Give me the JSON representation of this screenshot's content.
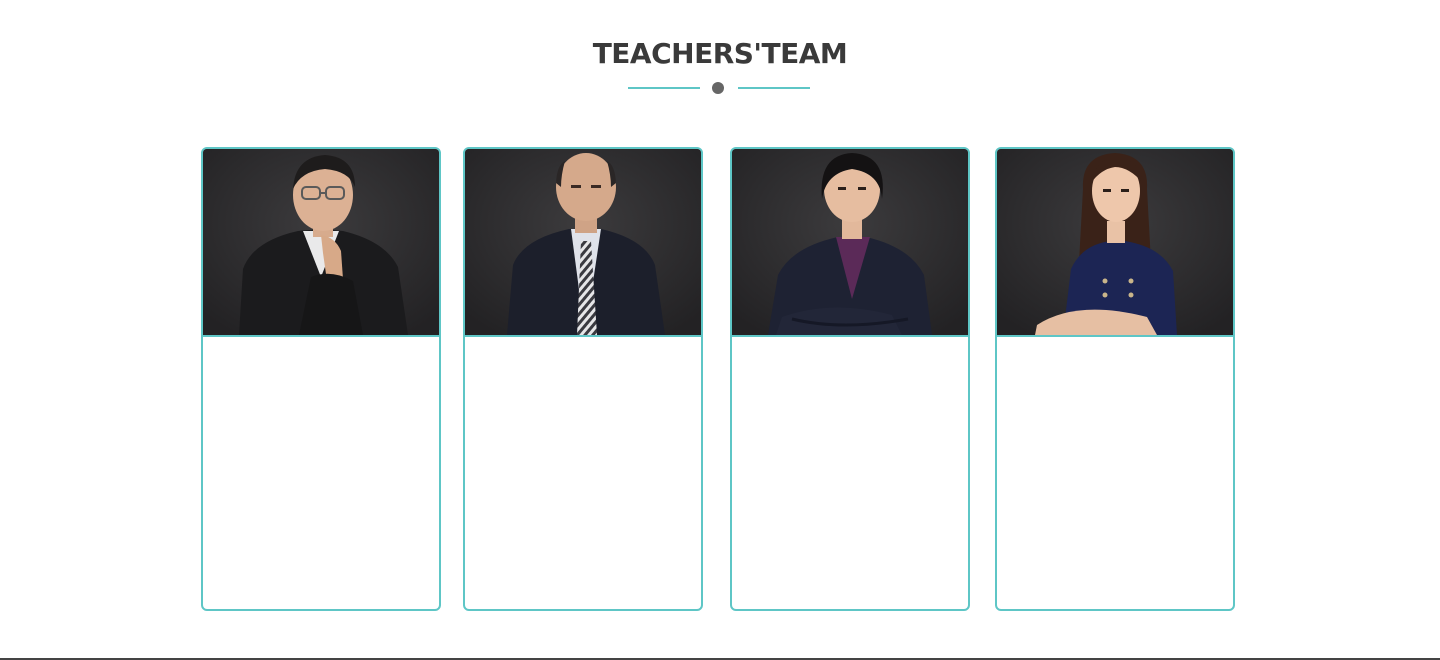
{
  "section": {
    "title": "TEACHERS'TEAM"
  },
  "colors": {
    "accent": "#5ec6c6",
    "title_text": "#3a3a3a",
    "divider_dot": "#666666",
    "photo_background": "#2e2d2f",
    "footer_rule": "#444444"
  },
  "teachers": [
    {
      "photo_icon": "teacher-portrait-man-glasses",
      "name": "",
      "bio": ""
    },
    {
      "photo_icon": "teacher-portrait-man-striped-tie",
      "name": "",
      "bio": ""
    },
    {
      "photo_icon": "teacher-portrait-woman-purple-blouse",
      "name": "",
      "bio": ""
    },
    {
      "photo_icon": "teacher-portrait-woman-navy-dress",
      "name": "",
      "bio": ""
    }
  ]
}
